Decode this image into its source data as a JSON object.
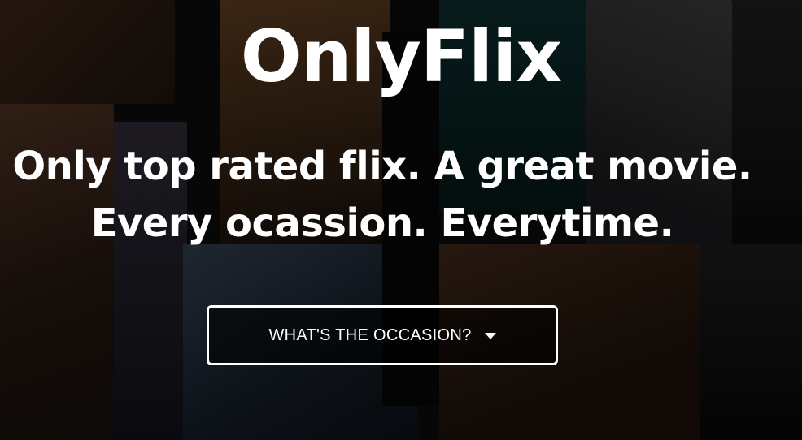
{
  "brand": {
    "name": "OnlyFlix"
  },
  "hero": {
    "tagline_line1": "Only top rated flix. A great movie.",
    "tagline_line2": "Every ocassion. Everytime."
  },
  "occasion_dropdown": {
    "label": "WHAT'S THE OCCASION?",
    "icon": "caret-down-icon"
  },
  "colors": {
    "text": "#ffffff",
    "button_border": "#ffffff",
    "background": "#0b0b0b"
  }
}
